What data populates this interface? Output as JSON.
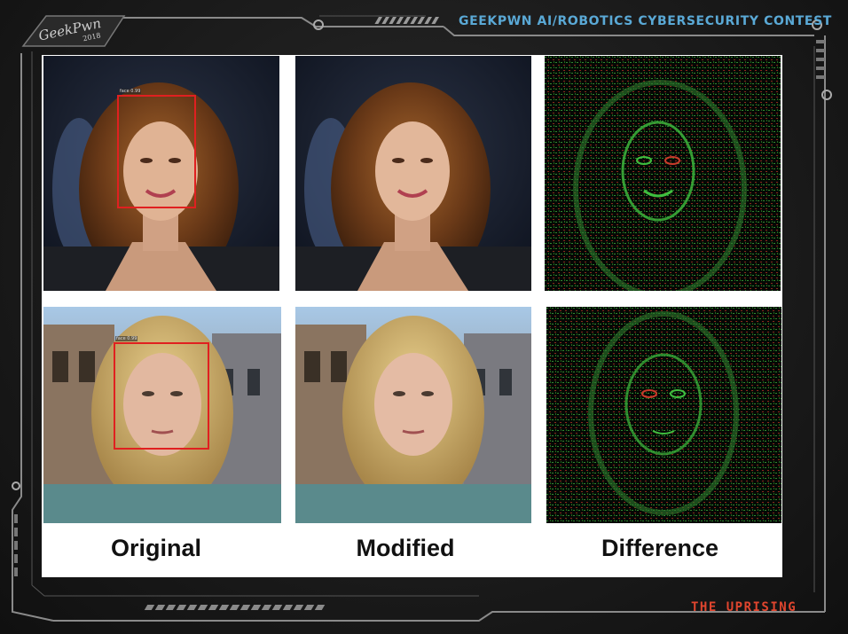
{
  "header": {
    "title": "GEEKPWN AI/ROBOTICS CYBERSECURITY CONTEST",
    "logo_text": "GeekPwn",
    "logo_year": "2018"
  },
  "footer": {
    "tagline": "THE UPRISING"
  },
  "columns": [
    {
      "label": "Original"
    },
    {
      "label": "Modified"
    },
    {
      "label": "Difference"
    }
  ],
  "rows": [
    {
      "subject": "woman with brown wavy hair",
      "detection": {
        "label": "face 0.99"
      }
    },
    {
      "subject": "woman with blonde hair",
      "detection": {
        "label": "face 0.99"
      }
    }
  ],
  "colors": {
    "accent_blue": "#5aa9d6",
    "accent_red": "#e0452e",
    "bbox_red": "#e02020",
    "diff_green": "#3fbf3f",
    "diff_red": "#c83a2a"
  },
  "icons": [
    "geekpwn-logo-icon",
    "frame-circuit-decoration-icon"
  ]
}
